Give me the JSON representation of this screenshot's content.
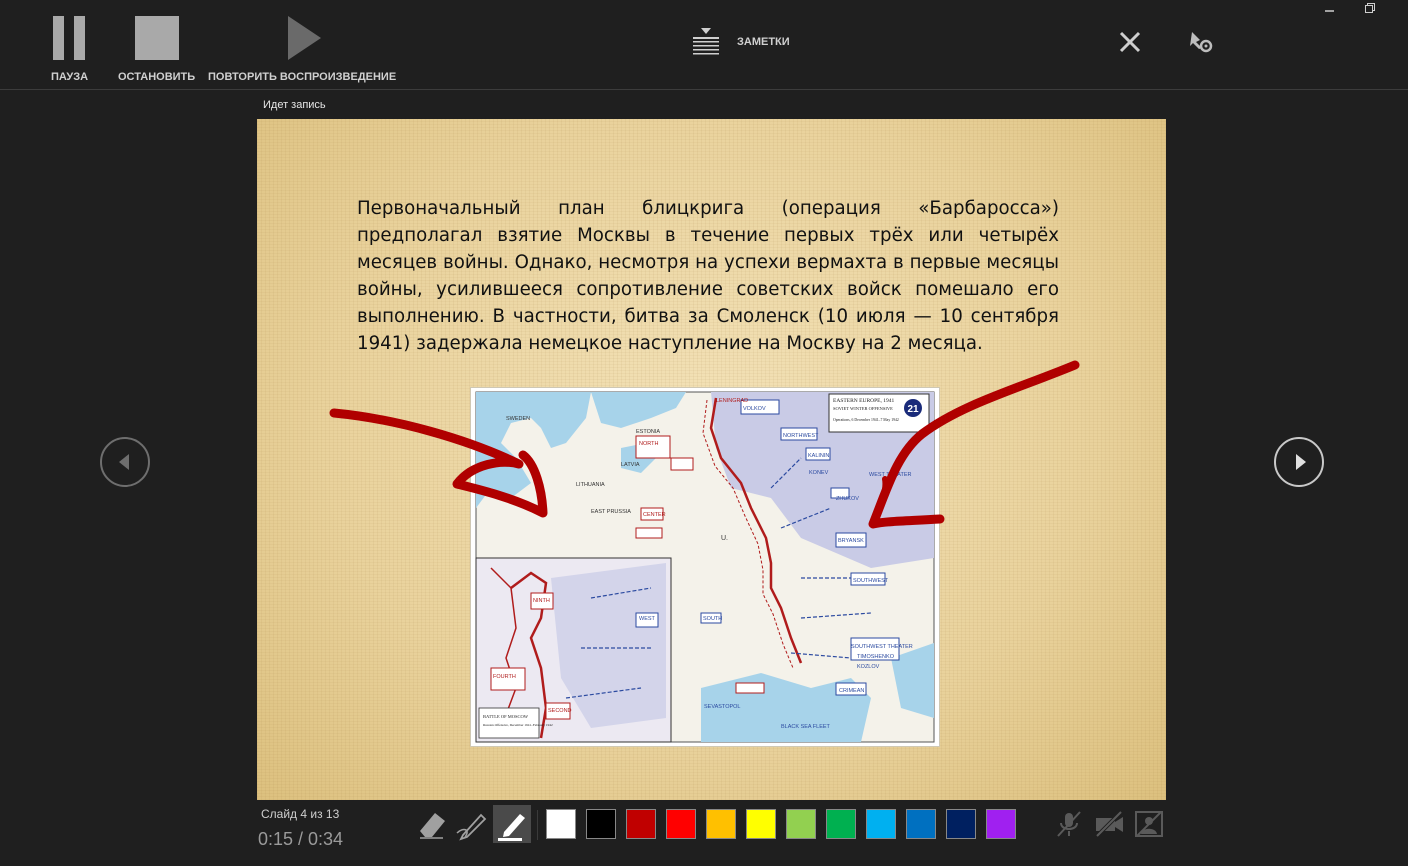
{
  "toolbar": {
    "pause_label": "ПАУЗА",
    "stop_label": "ОСТАНОВИТЬ",
    "replay_label": "ПОВТОРИТЬ ВОСПРОИЗВЕДЕНИЕ",
    "notes_label": "ЗАМЕТКИ"
  },
  "recording_status": "Идет запись",
  "slide": {
    "text": "Первоначальный план блицкрига (операция «Барбаросса») предполагал взятие Москвы в течение первых трёх или четырёх месяцев войны. Однако, несмотря на успехи вермахта в первые месяцы войны, усилившееся сопротивление советских войск помешало его выполнению. В частности, битва за Смоленск (10 июля — 10 сентября 1941) задержала немецкое наступление на Москву на 2 месяца.",
    "map": {
      "title": "EASTERN EUROPE, 1941",
      "subtitle": "SOVIET WINTER OFFENSIVE",
      "operations": "Operations, 6 December 1941–7 May 1942",
      "number": "21",
      "inset_title": "BATTLE OF MOSCOW",
      "inset_subtitle": "Russian Offensive, December 1941–February 1942",
      "labels": [
        "SWEDEN",
        "ESTONIA",
        "LATVIA",
        "LITHUANIA",
        "EAST PRUSSIA",
        "U.",
        "NORTH",
        "CENTER",
        "WEST",
        "SOUTH",
        "VOLKOV",
        "NORTHWEST",
        "KALININ",
        "WEST THEATER",
        "BRYANSK",
        "SOUTHWEST",
        "SOUTHWEST THEATER",
        "CRIMEAN",
        "BLACK SEA FLEET",
        "SEVASTOPOL",
        "KOZLOV",
        "TIMOSHENKO",
        "ZHUKOV",
        "LENINGRAD",
        "KONEV",
        "SECOND",
        "FOURTH",
        "NINTH"
      ]
    }
  },
  "footer": {
    "slide_counter": "Слайд 4 из 13",
    "timer": "0:15 / 0:34"
  },
  "pen_colors": [
    "#ffffff",
    "#000000",
    "#c00000",
    "#ff0000",
    "#ffc000",
    "#ffff00",
    "#92d050",
    "#00b050",
    "#00b0f0",
    "#0070c0",
    "#002060",
    "#a020f0"
  ],
  "icons": {
    "pause": "pause-icon",
    "stop": "stop-icon",
    "replay": "play-icon",
    "notes": "notes-icon",
    "close": "close-icon",
    "settings": "settings-icon",
    "eraser": "eraser-icon",
    "pen": "pen-icon",
    "highlighter": "highlighter-icon",
    "mic": "microphone-off-icon",
    "camera": "camera-off-icon",
    "camera_preview": "camera-preview-off-icon"
  }
}
